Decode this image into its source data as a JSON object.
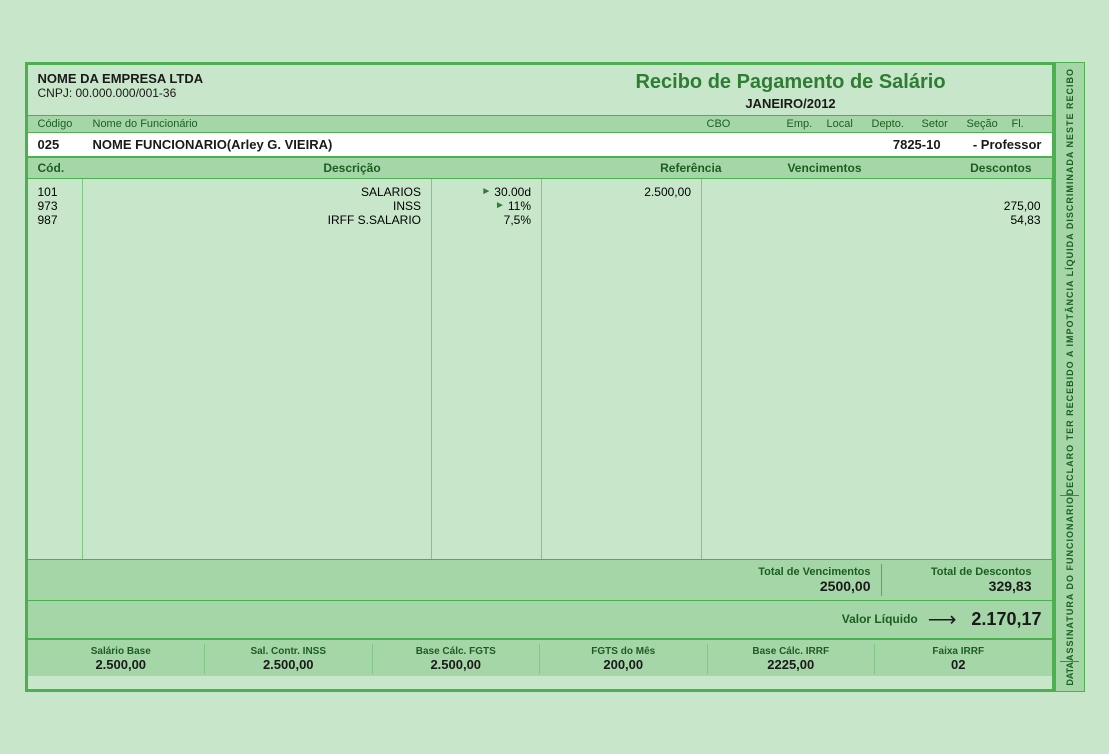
{
  "header": {
    "company_name": "NOME DA EMPRESA LTDA",
    "cnpj": "CNPJ: 00.000.000/001-36",
    "title": "Recibo de Pagamento de Salário",
    "period": "JANEIRO/2012"
  },
  "employee_header": {
    "col_codigo": "Código",
    "col_nome": "Nome do Funcionário",
    "col_cbo": "CBO",
    "col_emp": "Emp.",
    "col_local": "Local",
    "col_depto": "Depto.",
    "col_setor": "Setor",
    "col_secao": "Seção",
    "col_fl": "Fl."
  },
  "employee": {
    "codigo": "025",
    "nome": "NOME FUNCIONARIO(Arley G. VIEIRA)",
    "cbo": "7825-10",
    "cargo": "- Professor"
  },
  "table_header": {
    "cod": "Cód.",
    "descricao": "Descrição",
    "referencia": "Referência",
    "vencimentos": "Vencimentos",
    "descontos": "Descontos"
  },
  "items": [
    {
      "cod": "101",
      "descricao": "SALARIOS",
      "referencia": "30.00d",
      "vencimento": "2.500,00",
      "desconto": ""
    },
    {
      "cod": "973",
      "descricao": "INSS",
      "referencia": "11%",
      "vencimento": "",
      "desconto": "275,00"
    },
    {
      "cod": "987",
      "descricao": "IRFF S.SALARIO",
      "referencia": "7,5%",
      "vencimento": "",
      "desconto": "54,83"
    }
  ],
  "totals": {
    "vencimentos_label": "Total de Vencimentos",
    "vencimentos_value": "2500,00",
    "descontos_label": "Total de Descontos",
    "descontos_value": "329,83"
  },
  "liquido": {
    "label": "Valor Líquido",
    "value": "2.170,17"
  },
  "footer": {
    "salario_base_label": "Salário Base",
    "salario_base_value": "2.500,00",
    "sal_contr_inss_label": "Sal. Contr. INSS",
    "sal_contr_inss_value": "2.500,00",
    "base_calc_fgts_label": "Base Cálc. FGTS",
    "base_calc_fgts_value": "2.500,00",
    "fgts_mes_label": "FGTS do Mês",
    "fgts_mes_value": "200,00",
    "base_calc_irrf_label": "Base Cálc. IRRF",
    "base_calc_irrf_value": "2225,00",
    "faixa_irrf_label": "Faixa IRRF",
    "faixa_irrf_value": "02"
  },
  "sidebar": {
    "text1": "DECLARO TER RECEBIDO  A IMPOTÂNCIA LÍQUIDA DISCRIMINADA NESTE RECIBO",
    "text2": "ASSINATURA DO FUNCIONARIO",
    "text3": "DATA"
  }
}
